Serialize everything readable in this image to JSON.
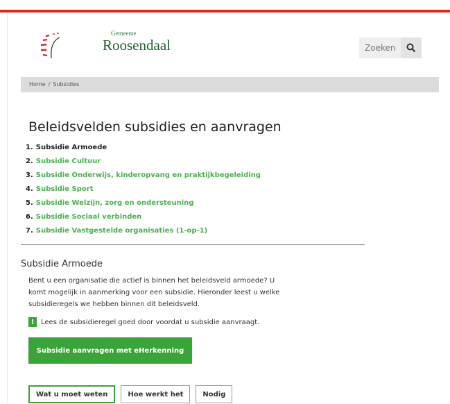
{
  "header": {
    "logo_small": "Gemeente",
    "logo_big": "Roosendaal",
    "search_placeholder": "Zoeken",
    "search_icon": "search-icon"
  },
  "breadcrumb": {
    "items": [
      "Home",
      "Subsidies"
    ],
    "separator": "/"
  },
  "page_title": "Beleidsvelden subsidies en aanvragen",
  "toc": [
    {
      "num": "1.",
      "label": "Subsidie Armoede",
      "current": true
    },
    {
      "num": "2.",
      "label": "Subsidie Cultuur",
      "current": false
    },
    {
      "num": "3.",
      "label": "Subsidie Onderwijs, kinderopvang en praktijkbegeleiding",
      "current": false
    },
    {
      "num": "4.",
      "label": "Subsidie Sport",
      "current": false
    },
    {
      "num": "5.",
      "label": "Subsidie Welzijn, zorg en ondersteuning",
      "current": false
    },
    {
      "num": "6.",
      "label": "Subsidie Sociaal verbinden",
      "current": false
    },
    {
      "num": "7.",
      "label": "Subsidie Vastgestelde organisaties (1-op-1)",
      "current": false
    }
  ],
  "section": {
    "title": "Subsidie Armoede",
    "intro": "Bent u een organisatie die actief is binnen het beleidsveld armoede? U komt mogelijk in aanmerking voor een subsidie. Hieronder leest u welke subsidieregels we hebben binnen dit beleidsveld.",
    "warning_icon": "!",
    "warning_text": "Lees de subsidieregel goed door voordat u subsidie aanvraagt.",
    "cta_label": "Subsidie aanvragen met eHerkenning"
  },
  "tabs": [
    {
      "label": "Wat u moet weten",
      "active": true
    },
    {
      "label": "Hoe werkt het",
      "active": false
    },
    {
      "label": "Nodig",
      "active": false
    }
  ],
  "colors": {
    "accent_red": "#e2261c",
    "green": "#3aa33a",
    "link_green": "#4caf50"
  }
}
